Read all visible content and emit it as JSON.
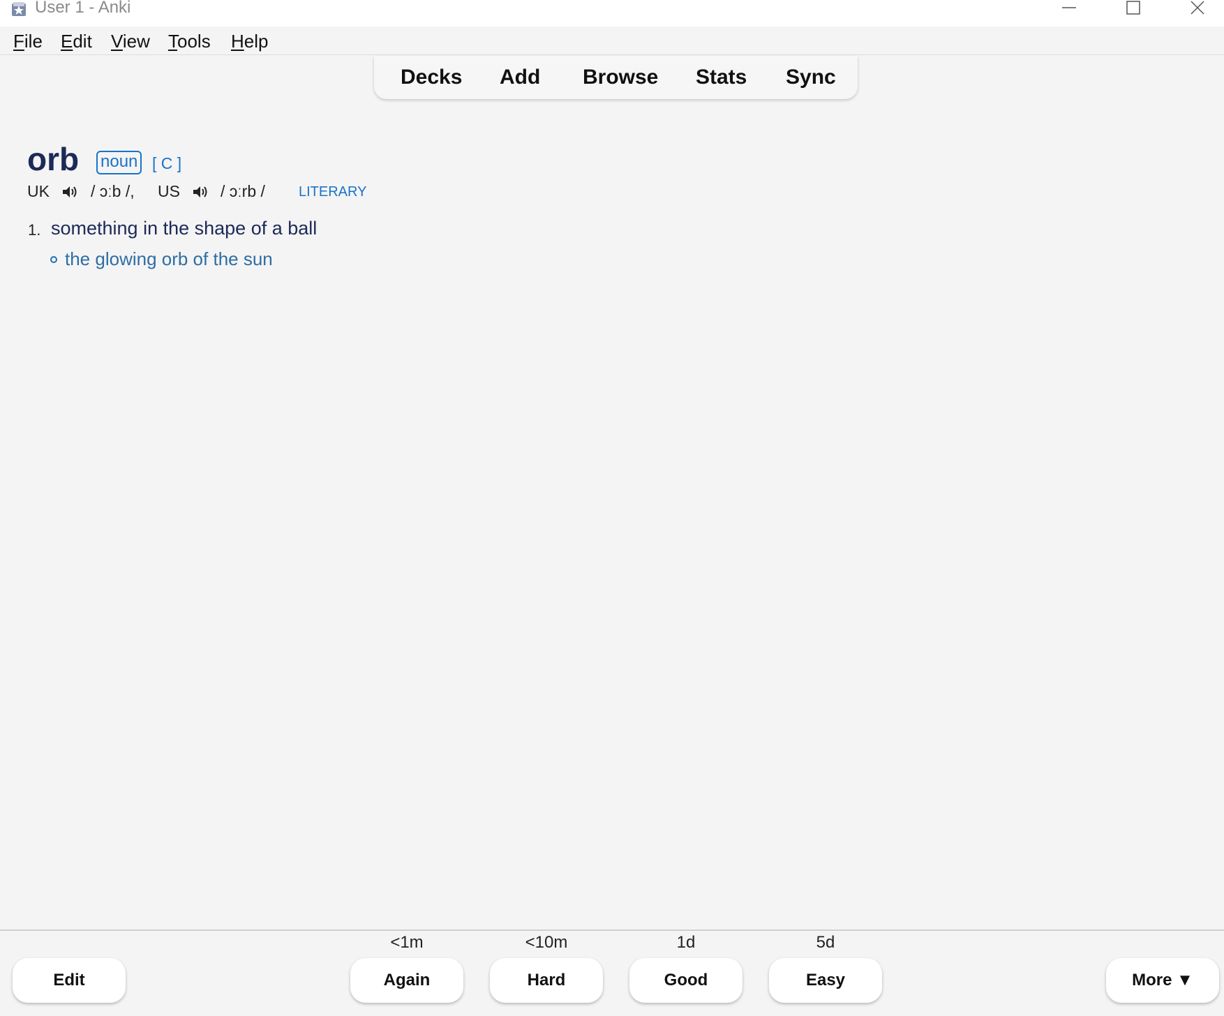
{
  "window": {
    "title": "User 1 - Anki",
    "icon": "anki-star-icon"
  },
  "menu": [
    {
      "mnemonic": "F",
      "rest": "ile"
    },
    {
      "mnemonic": "E",
      "rest": "dit"
    },
    {
      "mnemonic": "V",
      "rest": "iew"
    },
    {
      "mnemonic": "T",
      "rest": "ools"
    },
    {
      "mnemonic": "H",
      "rest": "elp"
    }
  ],
  "toolbar": {
    "decks": "Decks",
    "add": "Add",
    "browse": "Browse",
    "stats": "Stats",
    "sync": "Sync"
  },
  "card": {
    "headword": "orb",
    "pos": "noun",
    "grammar": "[ C ]",
    "uk_label": "UK",
    "uk_ipa": "/ ɔːb /,",
    "us_label": "US",
    "us_ipa": "/ ɔːrb /",
    "register": "LITERARY",
    "sense_number": "1.",
    "definition": "something in the shape of a ball",
    "example": "the glowing orb of the sun"
  },
  "answer_bar": {
    "edit": "Edit",
    "more": "More ▼",
    "buttons": [
      {
        "label": "Again",
        "interval": "<1m"
      },
      {
        "label": "Hard",
        "interval": "<10m"
      },
      {
        "label": "Good",
        "interval": "1d"
      },
      {
        "label": "Easy",
        "interval": "5d"
      }
    ]
  },
  "colors": {
    "headword": "#1d2a57",
    "accent_blue": "#1a73c7",
    "example": "#2e6da4",
    "background": "#f4f4f4"
  }
}
